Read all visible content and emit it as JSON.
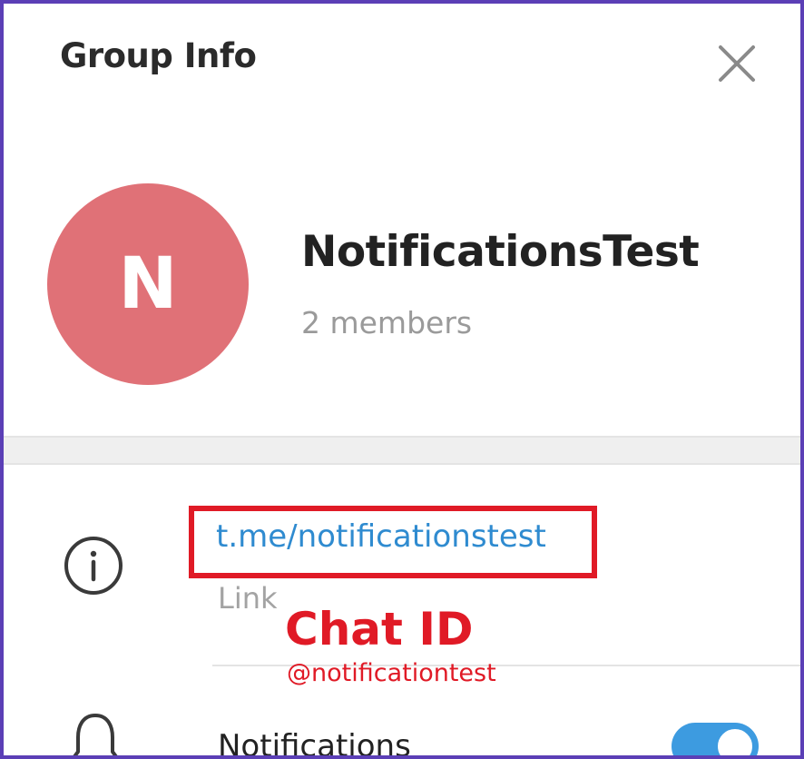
{
  "header": {
    "title": "Group Info",
    "close_icon": "close-icon"
  },
  "profile": {
    "avatar_initial": "N",
    "avatar_color": "#e07177",
    "name": "NotificationsTest",
    "members": "2 members"
  },
  "info_row": {
    "icon": "info-icon",
    "link": "t.me/notificationstest",
    "link_label": "Link"
  },
  "annotation": {
    "title": "Chat ID",
    "handle": "@notificationtest",
    "color": "#e01a26"
  },
  "notifications_row": {
    "icon": "bell-icon",
    "label": "Notifications",
    "enabled": true,
    "toggle_color": "#3d9be0"
  },
  "colors": {
    "frame": "#5b3fb6",
    "link": "#2f8bd0",
    "muted": "#9a9a9a"
  }
}
